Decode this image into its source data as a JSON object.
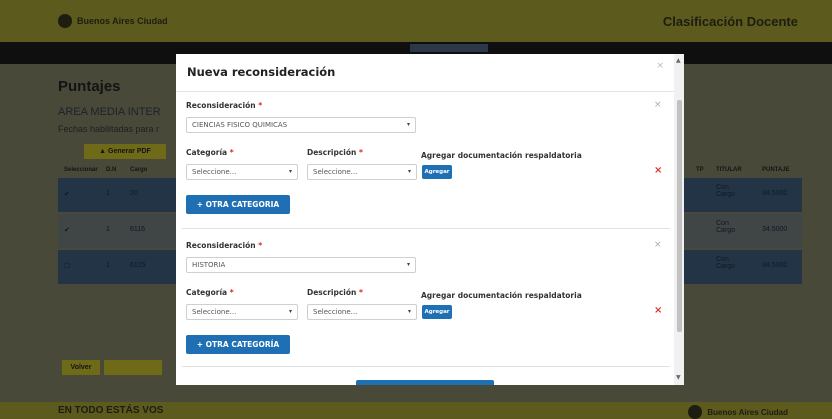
{
  "header": {
    "brand": "Buenos Aires Ciudad",
    "app_title": "Clasificación Docente"
  },
  "page": {
    "title": "Puntajes",
    "area": "AREA MEDIA INTER",
    "fechas": "Fechas habilitadas para r",
    "pdf_button": "Generar PDF",
    "pdf_icon": "document-icon"
  },
  "table": {
    "headers": [
      "Seleccionar",
      "D.N",
      "Cargo",
      "TP",
      "TITULAR",
      "PUNTAJE"
    ],
    "rows": [
      {
        "nro": "1",
        "cargo": "20",
        "titular": "Con Cargo",
        "puntaje": "34.5000"
      },
      {
        "nro": "1",
        "cargo": "6116",
        "titular": "Con Cargo",
        "puntaje": "34.5000"
      },
      {
        "nro": "1",
        "cargo": "6125",
        "titular": "Con Cargo",
        "puntaje": "34.5000"
      }
    ]
  },
  "bottom": {
    "volver": "Volver"
  },
  "footer": {
    "slogan": "EN TODO ESTÁS VOS",
    "brand": "Buenos Aires Ciudad"
  },
  "modal": {
    "title": "Nueva reconsideración",
    "close_icon": "close-icon",
    "blocks": [
      {
        "reconsideracion_label": "Reconsideración",
        "reconsideracion_value": "CIENCIAS FISICO QUIMICAS",
        "categoria_label": "Categoría",
        "categoria_value": "Seleccione...",
        "descripcion_label": "Descripción",
        "descripcion_value": "Seleccione...",
        "doc_label": "Agregar documentación respaldatoria",
        "agregar": "Agregar",
        "otra": "+ OTRA CATEGORIA"
      },
      {
        "reconsideracion_label": "Reconsideración",
        "reconsideracion_value": "HISTORIA",
        "categoria_label": "Categoría",
        "categoria_value": "Seleccione...",
        "descripcion_label": "Descripción",
        "descripcion_value": "Seleccione...",
        "doc_label": "Agregar documentación respaldatoria",
        "agregar": "Agregar",
        "otra": "+ OTRA CATEGORÍA"
      }
    ],
    "required_mark": "*",
    "remove_mark": "×",
    "collapse_mark": "×",
    "caret": "▾"
  },
  "colors": {
    "accent": "#1f6fb5",
    "danger": "#d9322e",
    "header_bar": "#5c5a1c"
  }
}
